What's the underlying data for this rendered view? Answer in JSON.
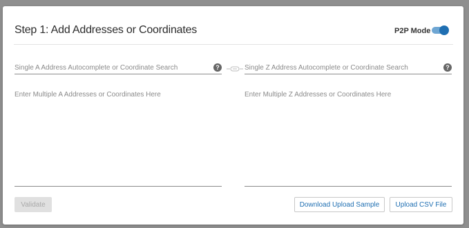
{
  "header": {
    "title": "Step 1: Add Addresses or Coordinates",
    "mode_label": "P2P Mode",
    "mode_enabled": true
  },
  "a_side": {
    "search_placeholder": "Single A Address Autocomplete or Coordinate Search",
    "multi_placeholder": "Enter Multiple A Addresses or Coordinates Here"
  },
  "z_side": {
    "search_placeholder": "Single Z Address Autocomplete or Coordinate Search",
    "multi_placeholder": "Enter Multiple Z Addresses or Coordinates Here"
  },
  "help_glyph": "?",
  "icons": {
    "help": "help-icon",
    "link": "link-icon"
  },
  "footer": {
    "validate_label": "Validate",
    "download_label": "Download Upload Sample",
    "upload_label": "Upload CSV File"
  },
  "colors": {
    "accent": "#1f6fb2",
    "toggle_track": "#6ea6d3",
    "disabled_bg": "#e0e0e0"
  }
}
